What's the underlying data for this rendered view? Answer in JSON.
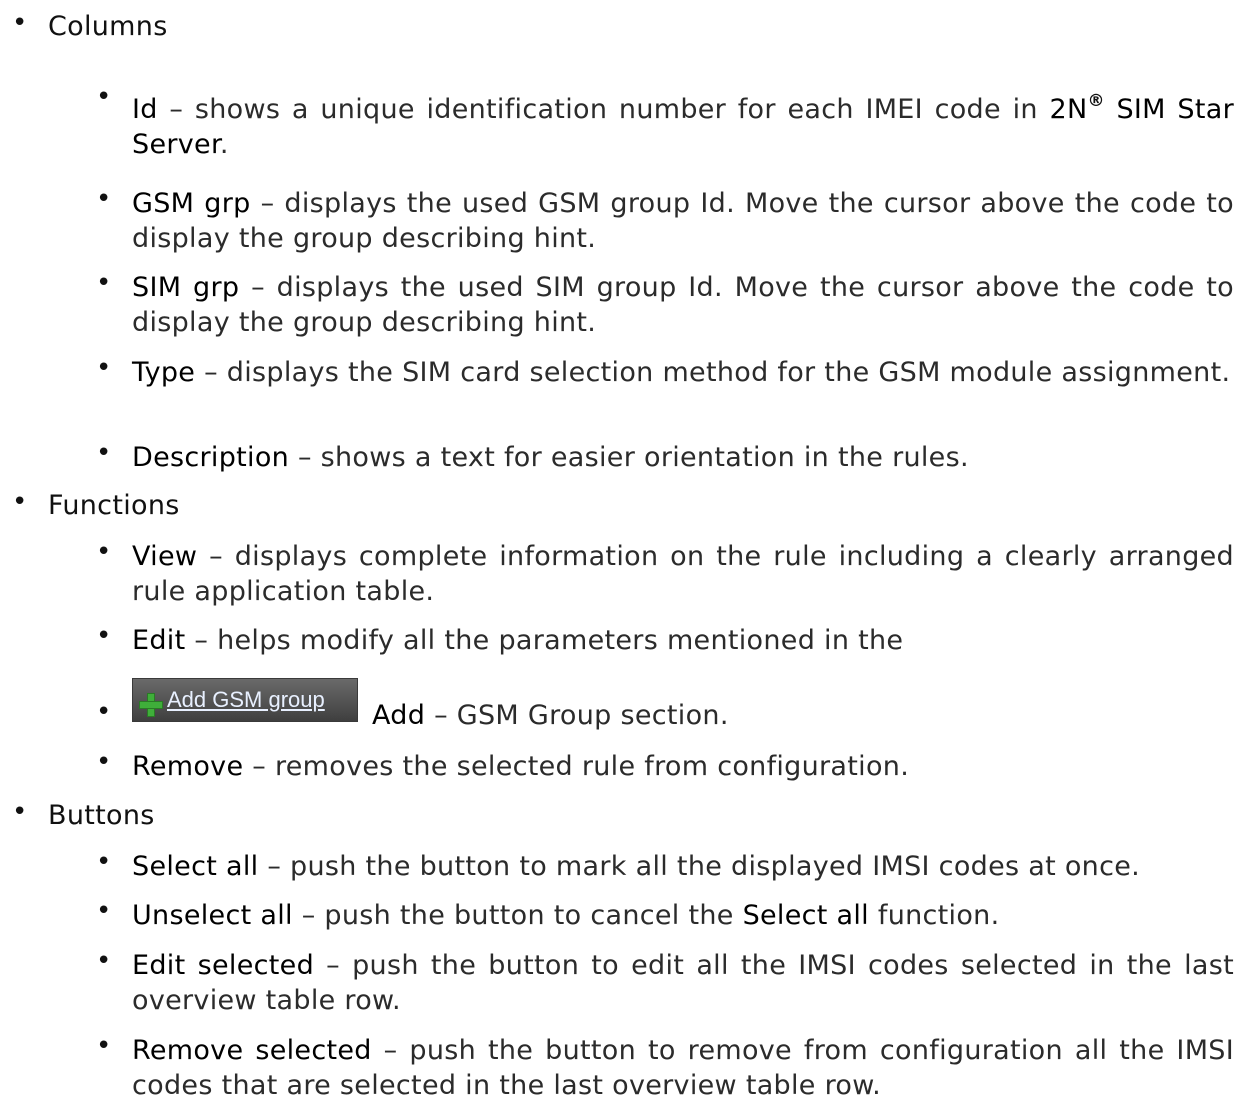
{
  "sections": {
    "columns": {
      "heading": "Columns"
    },
    "functions": {
      "heading": "Functions"
    },
    "buttons": {
      "heading": "Buttons"
    }
  },
  "columns_items": {
    "id": {
      "term": "Id",
      "desc_pre": " – shows a unique identification number for each IMEI code in ",
      "brand": "2N",
      "reg": "®",
      "brand_tail": " SIM Star Server",
      "period": "."
    },
    "gsm_grp": {
      "term": "GSM grp",
      "desc": " – displays the used GSM group Id. Move the cursor above the code to display the group describing hint."
    },
    "sim_grp": {
      "term": "SIM grp",
      "desc": " – displays the used SIM group Id. Move the cursor above the code to display the group describing hint."
    },
    "type": {
      "term": "Type",
      "desc": " – displays the SIM card selection method for the GSM module assignment."
    },
    "description": {
      "term": "Description",
      "desc": " – shows a text for easier orientation in the rules."
    }
  },
  "functions_items": {
    "view": {
      "term": "View",
      "desc": " – displays complete information on the rule including a clearly arranged rule application table."
    },
    "edit": {
      "term": "Edit",
      "desc": " – helps modify all the parameters mentioned in the"
    },
    "add": {
      "button_label": "Add GSM group",
      "term": "Add",
      "desc": " – GSM Group section."
    },
    "remove": {
      "term": "Remove",
      "desc": " – removes the selected rule from configuration."
    }
  },
  "buttons_items": {
    "select_all": {
      "term": "Select all",
      "desc": " – push the button to mark all the displayed IMSI codes at once."
    },
    "unselect_all": {
      "term": "Unselect all",
      "desc_pre": " – push the button to cancel the ",
      "term2": "Select all",
      "desc_post": " function."
    },
    "edit_selected": {
      "term": "Edit selected",
      "desc": " – push the button to edit all the IMSI codes selected in the last overview table row."
    },
    "remove_selected": {
      "term": "Remove selected",
      "desc": " – push the button to remove from configuration all the IMSI codes that are selected in the last overview table row."
    }
  },
  "colors": {
    "text": "#111111",
    "button_bg": "#4f4f4f",
    "plus_icon": "#3fae3a",
    "button_text": "#e8f0ff"
  }
}
